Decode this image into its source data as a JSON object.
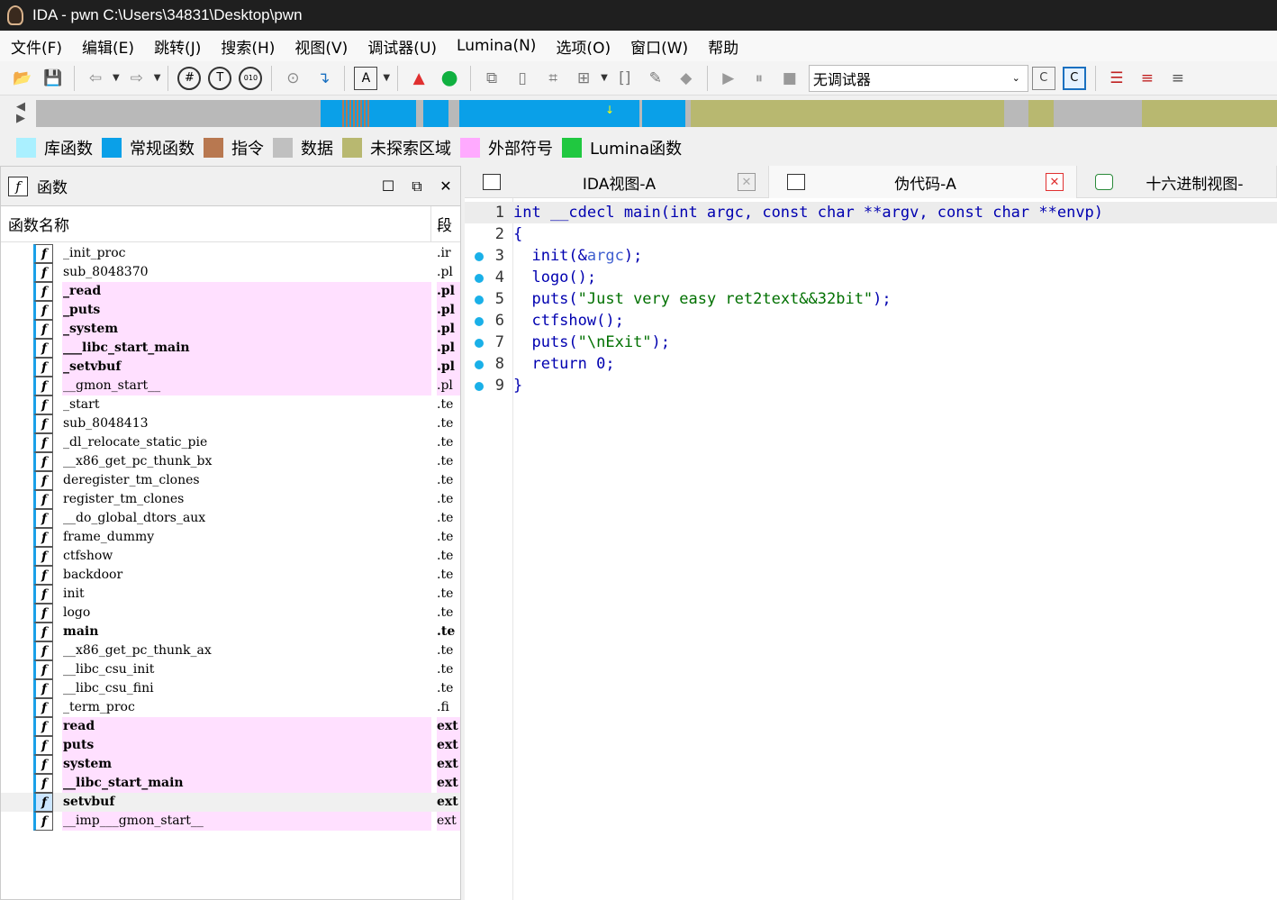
{
  "window": {
    "title": "IDA - pwn C:\\Users\\34831\\Desktop\\pwn"
  },
  "menu": [
    "文件(F)",
    "编辑(E)",
    "跳转(J)",
    "搜索(H)",
    "视图(V)",
    "调试器(U)",
    "Lumina(N)",
    "选项(O)",
    "窗口(W)",
    "帮助"
  ],
  "toolbar": {
    "debugger_select": "无调试器",
    "icons": [
      "open-icon",
      "save-icon",
      "back-icon",
      "forward-icon",
      "hash-icon",
      "text-icon",
      "binary-icon",
      "goto-icon",
      "jump-icon",
      "string-icon",
      "graph-icon",
      "run-icon",
      "clone-icon",
      "seg-icon",
      "struct-icon",
      "patch-icon",
      "edit-icon",
      "diamond-icon",
      "play-icon",
      "pause-icon",
      "stop-icon"
    ]
  },
  "legend": [
    {
      "label": "库函数",
      "color": "#aaf0ff"
    },
    {
      "label": "常规函数",
      "color": "#0aa0e8"
    },
    {
      "label": "指令",
      "color": "#b87850"
    },
    {
      "label": "数据",
      "color": "#c0c0c0"
    },
    {
      "label": "未探索区域",
      "color": "#b8b870"
    },
    {
      "label": "外部符号",
      "color": "#ffaaff"
    },
    {
      "label": "Lumina函数",
      "color": "#20c840"
    }
  ],
  "functions_panel": {
    "title": "函数",
    "col_name": "函数名称",
    "col_seg": "段",
    "rows": [
      {
        "name": "_init_proc",
        "seg": ".ir",
        "ext": false,
        "bold": false
      },
      {
        "name": "sub_8048370",
        "seg": ".pl",
        "ext": false,
        "bold": false
      },
      {
        "name": "_read",
        "seg": ".pl",
        "ext": true,
        "bold": true
      },
      {
        "name": "_puts",
        "seg": ".pl",
        "ext": true,
        "bold": true
      },
      {
        "name": "_system",
        "seg": ".pl",
        "ext": true,
        "bold": true
      },
      {
        "name": "___libc_start_main",
        "seg": ".pl",
        "ext": true,
        "bold": true
      },
      {
        "name": "_setvbuf",
        "seg": ".pl",
        "ext": true,
        "bold": true
      },
      {
        "name": "__gmon_start__",
        "seg": ".pl",
        "ext": true,
        "bold": false
      },
      {
        "name": "_start",
        "seg": ".te",
        "ext": false,
        "bold": false
      },
      {
        "name": "sub_8048413",
        "seg": ".te",
        "ext": false,
        "bold": false
      },
      {
        "name": "_dl_relocate_static_pie",
        "seg": ".te",
        "ext": false,
        "bold": false
      },
      {
        "name": "__x86_get_pc_thunk_bx",
        "seg": ".te",
        "ext": false,
        "bold": false
      },
      {
        "name": "deregister_tm_clones",
        "seg": ".te",
        "ext": false,
        "bold": false
      },
      {
        "name": "register_tm_clones",
        "seg": ".te",
        "ext": false,
        "bold": false
      },
      {
        "name": "__do_global_dtors_aux",
        "seg": ".te",
        "ext": false,
        "bold": false
      },
      {
        "name": "frame_dummy",
        "seg": ".te",
        "ext": false,
        "bold": false
      },
      {
        "name": "ctfshow",
        "seg": ".te",
        "ext": false,
        "bold": false
      },
      {
        "name": "backdoor",
        "seg": ".te",
        "ext": false,
        "bold": false
      },
      {
        "name": "init",
        "seg": ".te",
        "ext": false,
        "bold": false
      },
      {
        "name": "logo",
        "seg": ".te",
        "ext": false,
        "bold": false
      },
      {
        "name": "main",
        "seg": ".te",
        "ext": false,
        "bold": true
      },
      {
        "name": "__x86_get_pc_thunk_ax",
        "seg": ".te",
        "ext": false,
        "bold": false
      },
      {
        "name": "__libc_csu_init",
        "seg": ".te",
        "ext": false,
        "bold": false
      },
      {
        "name": "__libc_csu_fini",
        "seg": ".te",
        "ext": false,
        "bold": false
      },
      {
        "name": "_term_proc",
        "seg": ".fi",
        "ext": false,
        "bold": false
      },
      {
        "name": "read",
        "seg": "ext",
        "ext": true,
        "bold": true
      },
      {
        "name": "puts",
        "seg": "ext",
        "ext": true,
        "bold": true
      },
      {
        "name": "system",
        "seg": "ext",
        "ext": true,
        "bold": true
      },
      {
        "name": "__libc_start_main",
        "seg": "ext",
        "ext": true,
        "bold": true
      },
      {
        "name": "setvbuf",
        "seg": "ext",
        "ext": false,
        "bold": true,
        "selected": true
      },
      {
        "name": "__imp___gmon_start__",
        "seg": "ext",
        "ext": true,
        "bold": false
      }
    ]
  },
  "tabs": [
    {
      "label": "IDA视图-A",
      "active": false
    },
    {
      "label": "伪代码-A",
      "active": true
    },
    {
      "label": "十六进制视图-",
      "active": false
    }
  ],
  "pseudocode": [
    {
      "n": "1",
      "dot": false,
      "parts": [
        [
          "kw",
          "int __cdecl main(int argc, const char **argv, const char **envp)"
        ]
      ]
    },
    {
      "n": "2",
      "dot": false,
      "parts": [
        [
          "kw",
          "{"
        ]
      ]
    },
    {
      "n": "3",
      "dot": true,
      "parts": [
        [
          "kw",
          "  init(&"
        ],
        [
          "var",
          "argc"
        ],
        [
          "kw",
          ");"
        ]
      ]
    },
    {
      "n": "4",
      "dot": true,
      "parts": [
        [
          "kw",
          "  logo();"
        ]
      ]
    },
    {
      "n": "5",
      "dot": true,
      "parts": [
        [
          "kw",
          "  puts("
        ],
        [
          "str",
          "\"Just very easy ret2text&&32bit\""
        ],
        [
          "kw",
          ");"
        ]
      ]
    },
    {
      "n": "6",
      "dot": true,
      "parts": [
        [
          "kw",
          "  ctfshow();"
        ]
      ]
    },
    {
      "n": "7",
      "dot": true,
      "parts": [
        [
          "kw",
          "  puts("
        ],
        [
          "str",
          "\"\\nExit\""
        ],
        [
          "kw",
          ");"
        ]
      ]
    },
    {
      "n": "8",
      "dot": true,
      "parts": [
        [
          "kw",
          "  return "
        ],
        [
          "num",
          "0"
        ],
        [
          "kw",
          ";"
        ]
      ]
    },
    {
      "n": "9",
      "dot": true,
      "parts": [
        [
          "kw",
          "}"
        ]
      ]
    }
  ]
}
